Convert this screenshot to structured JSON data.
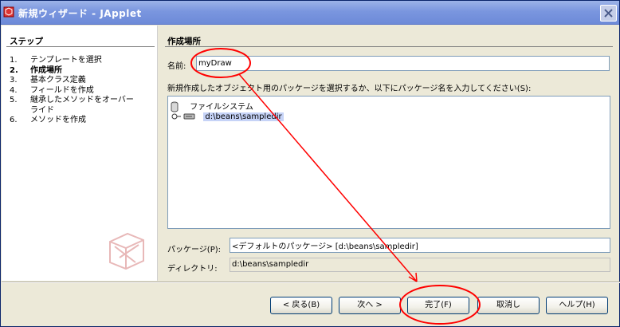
{
  "window": {
    "title": "新規ウィザード - JApplet",
    "close_icon": "close-icon"
  },
  "steps": {
    "title": "ステップ",
    "items": [
      {
        "num": "1.",
        "label": "テンプレートを選択"
      },
      {
        "num": "2.",
        "label": "作成場所"
      },
      {
        "num": "3.",
        "label": "基本クラス定義"
      },
      {
        "num": "4.",
        "label": "フィールドを作成"
      },
      {
        "num": "5.",
        "label": "継承したメソッドをオーバーライド"
      },
      {
        "num": "6.",
        "label": "メソッドを作成"
      }
    ],
    "current_index": 1
  },
  "main": {
    "section_title": "作成場所",
    "name_label": "名前:",
    "name_value": "myDraw",
    "instructions": "新規作成したオブジェクト用のパッケージを選択するか、以下にパッケージ名を入力してください(S):",
    "tree": {
      "root_label": "ファイルシステム",
      "child_label": "d:\\beans\\sampledir"
    },
    "package_label": "パッケージ(P):",
    "package_value": "<デフォルトのパッケージ> [d:\\beans\\sampledir]",
    "directory_label": "ディレクトリ:",
    "directory_value": "d:\\beans\\sampledir"
  },
  "buttons": {
    "back": "< 戻る(B)",
    "next": "次へ >",
    "finish": "完了(F)",
    "cancel": "取消し",
    "help": "ヘルプ(H)"
  },
  "colors": {
    "titlebar": "#7a96df",
    "annotation": "#ff0000",
    "selection": "#c6d3f7"
  }
}
